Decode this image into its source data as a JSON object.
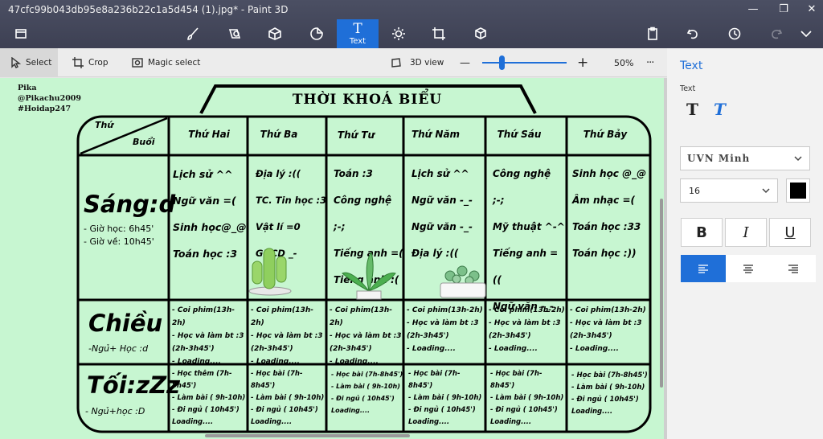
{
  "window": {
    "title": "47cfc99b043db95e8a236b22c1a5d454 (1).jpg* - Paint 3D",
    "minimize": "—",
    "restore": "❐",
    "close": "✕"
  },
  "toolbar": {
    "active_tool_label": "Text",
    "tools": [
      "menu-icon",
      "brushes-icon",
      "2d-shapes-icon",
      "3d-shapes-icon",
      "stickers-icon",
      "text-icon",
      "effects-icon",
      "canvas-icon",
      "3d-library-icon",
      "paste-icon",
      "undo-icon",
      "history-icon",
      "redo-icon",
      "expand-icon"
    ]
  },
  "subbar": {
    "select": "Select",
    "crop": "Crop",
    "magic_select": "Magic select",
    "view3d": "3D view",
    "zoom_minus": "—",
    "zoom_plus": "+",
    "zoom_level": "50%",
    "more": "···"
  },
  "canvas": {
    "credits": [
      "Pika",
      "@Pikachu2009",
      "#Hoidap247"
    ],
    "title": "THỜI KHOÁ BIỂU",
    "corner_top": "Thứ",
    "corner_bottom": "Buổi",
    "days": [
      "Thứ Hai",
      "Thứ Ba",
      "Thứ Tư",
      "Thứ Năm",
      "Thứ Sáu",
      "Thứ Bảy"
    ],
    "sessions": {
      "morning": {
        "name": "Sáng:d",
        "notes": [
          "- Giờ học: 6h45'",
          "- Giờ về: 10h45'"
        ]
      },
      "afternoon": {
        "name": "Chiều",
        "notes": [
          "-Ngủ+ Học :d"
        ]
      },
      "evening": {
        "name": "Tối:zZz",
        "notes": [
          "- Ngủ+học :D"
        ]
      }
    },
    "morning_subjects": [
      [
        "Lịch sử ^^",
        "Ngữ văn =(",
        "Sinh học@_@",
        "Toán học :3"
      ],
      [
        "Địa lý :((",
        "TC. Tin học :3",
        "Vật lí =0",
        "GDCD _-"
      ],
      [
        "Toán :3",
        "Công nghệ ;-;",
        "Tiếng anh =(",
        "Tiếng anh :("
      ],
      [
        "Lịch sử ^^",
        "Ngữ văn -_-",
        "Ngữ văn -_-",
        "Địa lý :(("
      ],
      [
        "Công nghệ ;-;",
        "Mỹ thuật ^-^",
        "Tiếng anh =((",
        "Ngữ văn -_-"
      ],
      [
        "Sinh học @_@",
        "Âm nhạc =(",
        "Toán học :33",
        "Toán học :))"
      ]
    ],
    "afternoon_lines": [
      "- Coi phim(13h-2h)",
      "- Học và làm bt :3",
      "(2h-3h45')",
      "- Loading...."
    ],
    "evening_lines": [
      "- Học bài (7h-8h45')",
      "- Làm bài ( 9h-10h)",
      "- Đi ngủ ( 10h45')",
      "Loading...."
    ],
    "evening_first_line_mon": "- Học thêm (7h-8h45')"
  },
  "panel": {
    "heading": "Text",
    "label": "Text",
    "plain_text_icon": "T",
    "fancy_text_icon": "T",
    "font_name": "UVN Minh",
    "font_size": "16",
    "bold": "B",
    "italic": "I",
    "underline": "U",
    "text_color": "#000000"
  }
}
